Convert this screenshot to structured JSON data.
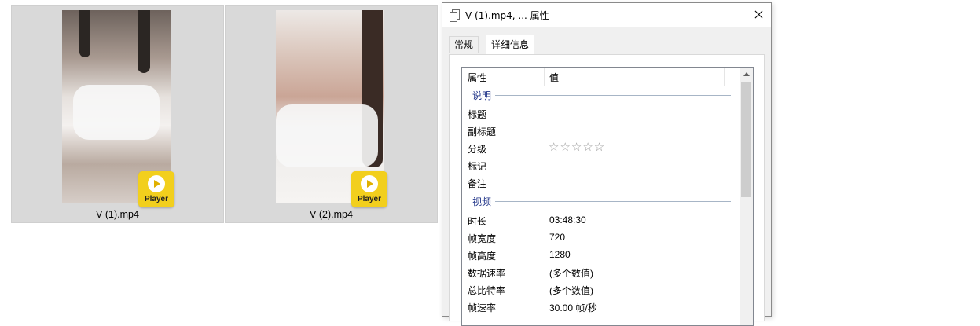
{
  "explorer": {
    "files": [
      {
        "name": "V (1).mp4",
        "badge": "Player"
      },
      {
        "name": "V (2).mp4",
        "badge": "Player"
      }
    ]
  },
  "dialog": {
    "title": "V (1).mp4, ... 属性",
    "tabs": [
      {
        "label": "常规",
        "selected": false
      },
      {
        "label": "详细信息",
        "selected": true
      }
    ],
    "columns": {
      "name": "属性",
      "value": "值"
    },
    "groups": [
      {
        "label": "说明",
        "rows": [
          {
            "name": "标题",
            "value": ""
          },
          {
            "name": "副标题",
            "value": ""
          },
          {
            "name": "分级",
            "value": "☆☆☆☆☆",
            "rating": 0
          },
          {
            "name": "标记",
            "value": ""
          },
          {
            "name": "备注",
            "value": ""
          }
        ]
      },
      {
        "label": "视频",
        "rows": [
          {
            "name": "时长",
            "value": "03:48:30"
          },
          {
            "name": "帧宽度",
            "value": "720"
          },
          {
            "name": "帧高度",
            "value": "1280"
          },
          {
            "name": "数据速率",
            "value": "(多个数值)"
          },
          {
            "name": "总比特率",
            "value": "(多个数值)"
          },
          {
            "name": "帧速率",
            "value": "30.00 帧/秒"
          }
        ]
      }
    ]
  },
  "colors": {
    "group_label": "#1e3287",
    "badge": "#f2cf1d",
    "selection_bg": "#d9d9d9"
  }
}
